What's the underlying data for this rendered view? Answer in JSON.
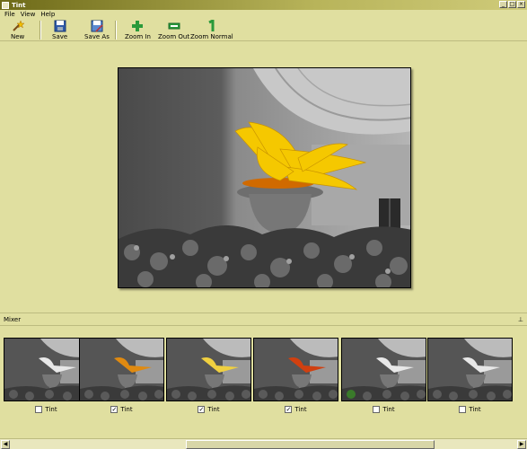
{
  "window": {
    "title": "Tint"
  },
  "menu": [
    "File",
    "View",
    "Help"
  ],
  "toolbar": {
    "new": "New",
    "save": "Save",
    "save_as": "Save As",
    "zoom_in": "Zoom In",
    "zoom_out": "Zoom Out",
    "zoom_normal": "Zoom Normal"
  },
  "mixer": {
    "title": "Mixer",
    "thumbs": [
      {
        "label": "Tint",
        "checked": false,
        "tint": "none"
      },
      {
        "label": "Tint",
        "checked": true,
        "tint": "orange"
      },
      {
        "label": "Tint",
        "checked": true,
        "tint": "yellow"
      },
      {
        "label": "Tint",
        "checked": true,
        "tint": "red"
      },
      {
        "label": "Tint",
        "checked": false,
        "tint": "green"
      },
      {
        "label": "Tint",
        "checked": false,
        "tint": "none"
      }
    ]
  },
  "colors": {
    "background": "#e0dfa0",
    "flower": "#f5c800",
    "pot_rim": "#d06a00"
  }
}
